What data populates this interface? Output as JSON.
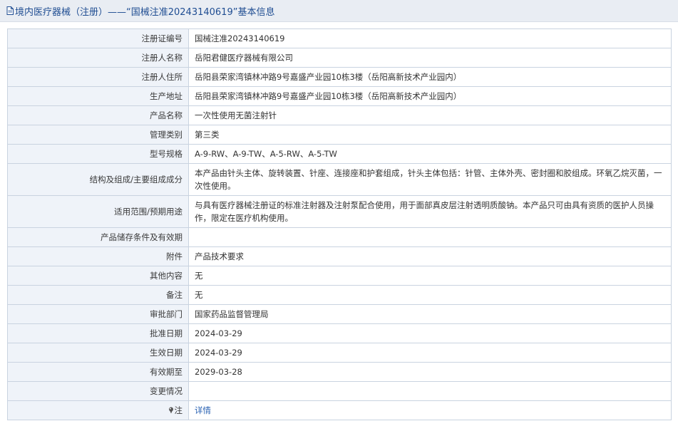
{
  "header": {
    "title": "境内医疗器械（注册）——“国械注准20243140619”基本信息"
  },
  "rows": [
    {
      "label": "注册证编号",
      "value": "国械注准20243140619"
    },
    {
      "label": "注册人名称",
      "value": "岳阳君健医疗器械有限公司"
    },
    {
      "label": "注册人住所",
      "value": "岳阳县荣家湾镇林冲路9号嘉盛产业园10栋3楼（岳阳高新技术产业园内）"
    },
    {
      "label": "生产地址",
      "value": "岳阳县荣家湾镇林冲路9号嘉盛产业园10栋3楼（岳阳高新技术产业园内）"
    },
    {
      "label": "产品名称",
      "value": "一次性使用无菌注射针"
    },
    {
      "label": "管理类别",
      "value": "第三类"
    },
    {
      "label": "型号规格",
      "value": "A-9-RW、A-9-TW、A-5-RW、A-5-TW"
    },
    {
      "label": "结构及组成/主要组成成分",
      "value": "本产品由针头主体、旋转装置、针座、连接座和护套组成，针头主体包括：针管、主体外壳、密封圈和胶组成。环氧乙烷灭菌，一次性使用。"
    },
    {
      "label": "适用范围/预期用途",
      "value": "与具有医疗器械注册证的标准注射器及注射泵配合使用，用于面部真皮层注射透明质酸钠。本产品只可由具有资质的医护人员操作，限定在医疗机构使用。"
    },
    {
      "label": "产品储存条件及有效期",
      "value": ""
    },
    {
      "label": "附件",
      "value": "产品技术要求"
    },
    {
      "label": "其他内容",
      "value": "无"
    },
    {
      "label": "备注",
      "value": "无"
    },
    {
      "label": "审批部门",
      "value": "国家药品监督管理局"
    },
    {
      "label": "批准日期",
      "value": "2024-03-29"
    },
    {
      "label": "生效日期",
      "value": "2024-03-29"
    },
    {
      "label": "有效期至",
      "value": "2029-03-28"
    },
    {
      "label": "变更情况",
      "value": ""
    }
  ],
  "note": {
    "label": "注",
    "link_text": "详情"
  },
  "colors": {
    "header_bg": "#e9edf3",
    "header_text": "#1f4d92",
    "label_bg": "#eff3f9",
    "border": "#c9d3e0",
    "link": "#2a62b3"
  }
}
